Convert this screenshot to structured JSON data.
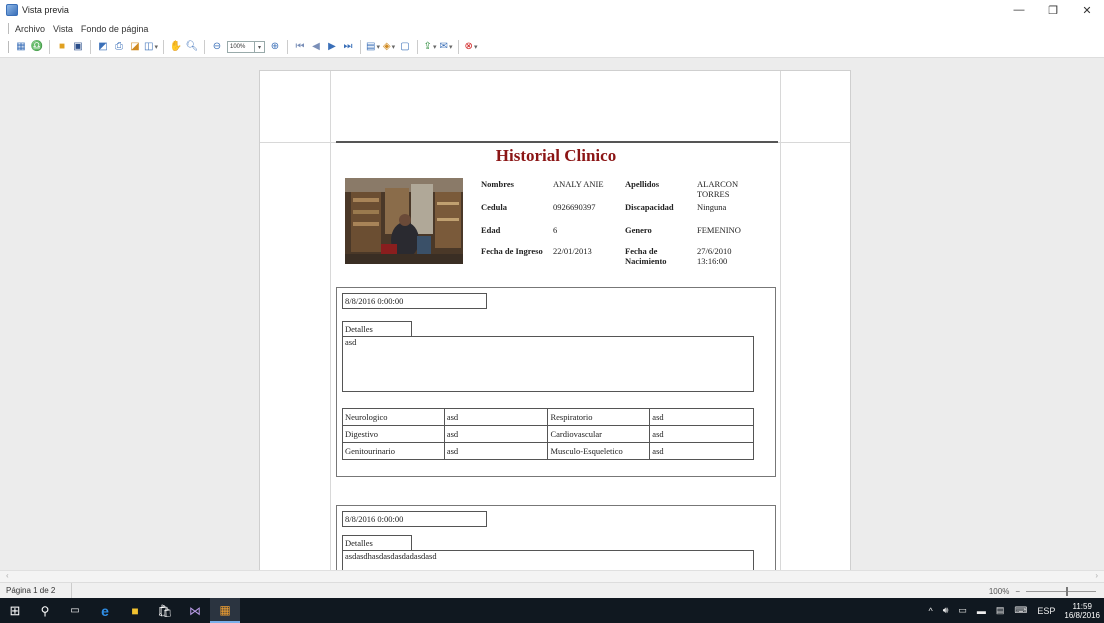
{
  "window": {
    "title": "Vista previa",
    "controls": [
      "—",
      "❐",
      "✕"
    ]
  },
  "menu": [
    "Archivo",
    "Vista",
    "Fondo de página"
  ],
  "toolbar": {
    "zoom_value": "100%"
  },
  "report": {
    "title": "Historial Clinico",
    "fields": {
      "nombres_label": "Nombres",
      "nombres_value": "ANALY ANIE",
      "apellidos_label": "Apellidos",
      "apellidos_value": "ALARCON TORRES",
      "cedula_label": "Cedula",
      "cedula_value": "0926690397",
      "discapacidad_label": "Discapacidad",
      "discapacidad_value": "Ninguna",
      "edad_label": "Edad",
      "edad_value": "6",
      "genero_label": "Genero",
      "genero_value": "FEMENINO",
      "ingreso_label": "Fecha de Ingreso",
      "ingreso_value": "22/01/2013",
      "nacimiento_label": "Fecha de Nacimiento",
      "nacimiento_value": "27/6/2010 13:16:00"
    },
    "records": [
      {
        "date": "8/8/2016 0:00:00",
        "details_label": "Detalles",
        "details": "asd",
        "systems": [
          [
            "Neurologico",
            "asd",
            "Respiratorio",
            "asd"
          ],
          [
            "Digestivo",
            "asd",
            "Cardiovascular",
            "asd"
          ],
          [
            "Genitourinario",
            "asd",
            "Musculo-Esqueletico",
            "asd"
          ]
        ]
      },
      {
        "date": "8/8/2016 0:00:00",
        "details_label": "Detalles",
        "details": "asdasdhasdasdasdadasdasd"
      }
    ]
  },
  "status": {
    "page": "Página 1 de 2",
    "zoom": "100%"
  },
  "tray": {
    "language": "ESP",
    "time": "11:59",
    "date": "16/8/2016"
  },
  "colors": {
    "title_red": "#8b1515",
    "taskbar": "#101820",
    "preview_bg": "#ececec"
  }
}
